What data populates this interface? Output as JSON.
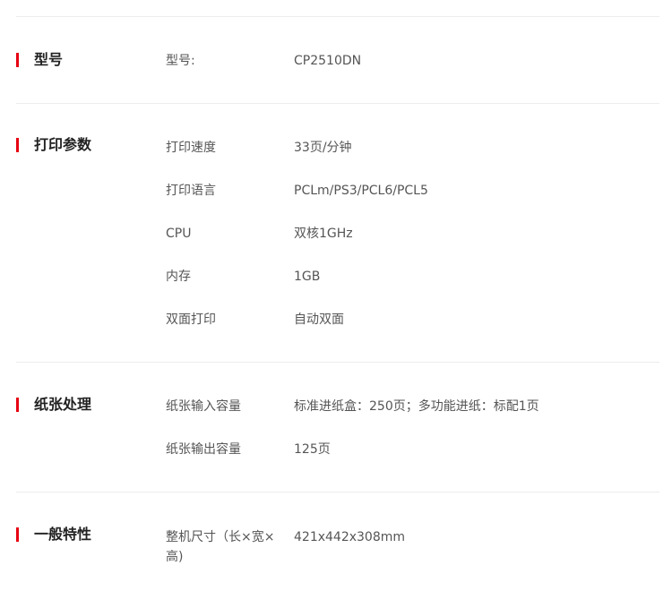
{
  "sections": [
    {
      "title": "型号",
      "rows": [
        {
          "label": "型号:",
          "value": "CP2510DN"
        }
      ]
    },
    {
      "title": "打印参数",
      "rows": [
        {
          "label": "打印速度",
          "value": "33页/分钟"
        },
        {
          "label": "打印语言",
          "value": "PCLm/PS3/PCL6/PCL5"
        },
        {
          "label": "CPU",
          "value": "双核1GHz"
        },
        {
          "label": "内存",
          "value": "1GB"
        },
        {
          "label": "双面打印",
          "value": "自动双面"
        }
      ]
    },
    {
      "title": "纸张处理",
      "rows": [
        {
          "label": "纸张输入容量",
          "value": "标准进纸盒：250页；多功能进纸：标配1页"
        },
        {
          "label": "纸张输出容量",
          "value": "125页"
        }
      ]
    },
    {
      "title": "一般特性",
      "rows": [
        {
          "label": "整机尺寸（长×宽×高)",
          "value": "421x442x308mm"
        }
      ]
    }
  ],
  "colors": {
    "accent": "#e60012",
    "divider": "#ececec",
    "text": "#555555",
    "title": "#222222"
  }
}
